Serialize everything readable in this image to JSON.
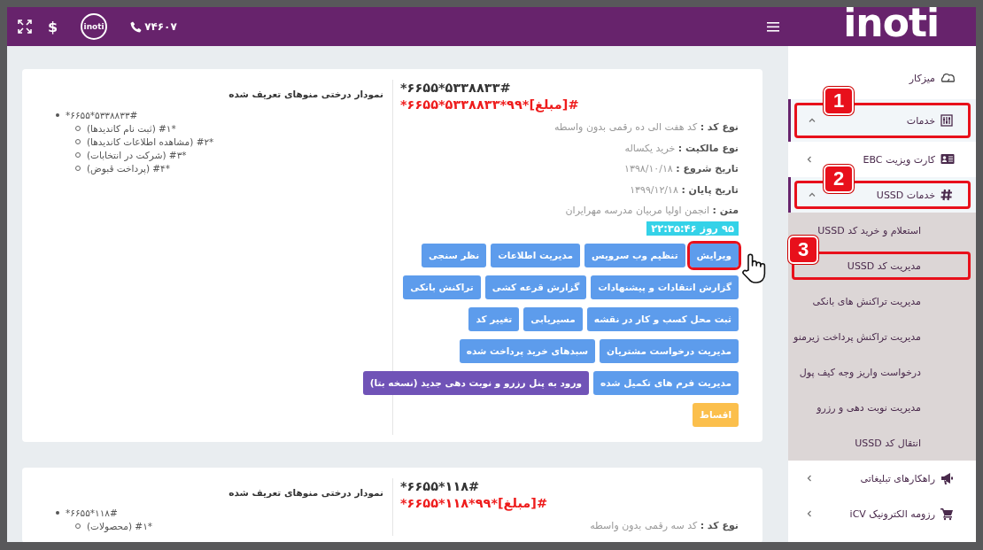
{
  "header": {
    "logo": "inoti",
    "badge_logo": "inoti",
    "currency": "$",
    "phone": "۷۴۶۰۷"
  },
  "cards": [
    {
      "code": "*۶۶۵۵*۵۳۳۸۸۳۳#",
      "dial_code": "*۶۶۵۵*۵۳۳۸۸۳۳*۹۹*[مبلغ]#",
      "fields": [
        {
          "label": "نوع کد :",
          "value": "کد هفت الی ده رقمی بدون واسطه"
        },
        {
          "label": "نوع مالکیت :",
          "value": "خرید یکساله"
        },
        {
          "label": "تاریخ شروع :",
          "value": "۱۳۹۸/۱۰/۱۸"
        },
        {
          "label": "تاریخ پایان :",
          "value": "۱۳۹۹/۱۲/۱۸"
        },
        {
          "label": "متن :",
          "value": "انجمن اولیا مربیان مدرسه مهرایران"
        }
      ],
      "timer": "۹۵ روز ۲۲:۳۵:۴۶",
      "button_rows": [
        [
          {
            "label": "ویرایش",
            "color": "#5d9cec",
            "highlighted": true
          },
          {
            "label": "تنظیم وب سرویس",
            "color": "#5d9cec",
            "highlighted": false
          },
          {
            "label": "مدیریت اطلاعات",
            "color": "#5d9cec",
            "highlighted": false
          },
          {
            "label": "نظر سنجی",
            "color": "#5d9cec",
            "highlighted": false
          }
        ],
        [
          {
            "label": "گزارش انتقادات و پیشنهادات",
            "color": "#5d9cec",
            "highlighted": false
          },
          {
            "label": "گزارش قرعه کشی",
            "color": "#5d9cec",
            "highlighted": false
          },
          {
            "label": "تراکنش بانکی",
            "color": "#5d9cec",
            "highlighted": false
          }
        ],
        [
          {
            "label": "ثبت محل کسب و کار در نقشه",
            "color": "#5d9cec",
            "highlighted": false
          },
          {
            "label": "مسیریابی",
            "color": "#5d9cec",
            "highlighted": false
          },
          {
            "label": "تغییر کد",
            "color": "#5d9cec",
            "highlighted": false
          }
        ],
        [
          {
            "label": "مدیریت درخواست مشتریان",
            "color": "#5d9cec",
            "highlighted": false
          },
          {
            "label": "سبدهای خرید پرداخت شده",
            "color": "#5d9cec",
            "highlighted": false
          }
        ],
        [
          {
            "label": "مدیریت فرم های تکمیل شده",
            "color": "#5d9cec",
            "highlighted": false
          },
          {
            "label": "ورود به پنل رزرو و نوبت دهی جدید (نسخه بتا)",
            "color": "#7053b7",
            "highlighted": false
          }
        ],
        [
          {
            "label": "اقساط",
            "color": "#fbbf4c",
            "highlighted": false
          }
        ]
      ],
      "tree": {
        "title": "نمودار درختی منوهای تعریف شده",
        "root": "*۶۶۵۵*۵۳۳۸۸۳۳#",
        "children": [
          "(ثبت نام کاندیدها) #۱*",
          "(مشاهده اطلاعات کاندیدها) #۲*",
          "(شرکت در انتخابات) #۳*",
          "(پرداخت قبوض) #۴*"
        ]
      }
    },
    {
      "code": "*۶۶۵۵*۱۱۸#",
      "dial_code": "*۶۶۵۵*۱۱۸*۹۹*[مبلغ]#",
      "fields": [
        {
          "label": "نوع کد :",
          "value": "کد سه رقمی بدون واسطه"
        }
      ],
      "tree": {
        "title": "نمودار درختی منوهای تعریف شده",
        "root": "*۶۶۵۵*۱۱۸#",
        "children": [
          "(محصولات) #۱*"
        ]
      }
    }
  ],
  "sidebar": {
    "items": [
      {
        "label": "میزکار",
        "selected": false
      },
      {
        "label": "خدمات",
        "selected": true,
        "expanded": true,
        "badge": "1",
        "children": [
          {
            "label": "کارت ویزیت EBC",
            "selected": false,
            "expanded": false
          },
          {
            "label": "خدمات USSD",
            "selected": true,
            "expanded": true,
            "badge": "2",
            "children": [
              {
                "label": "استعلام و خرید کد USSD",
                "selected": false
              },
              {
                "label": "مدیریت کد USSD",
                "selected": false,
                "badge": "3"
              },
              {
                "label": "مدیریت تراکنش های بانکی",
                "selected": false
              },
              {
                "label": "مدیریت تراکنش پرداخت زیرمنو",
                "selected": false
              },
              {
                "label": "درخواست واریز وجه کیف پول",
                "selected": false
              },
              {
                "label": "مدیریت نوبت دهی و رزرو",
                "selected": false
              },
              {
                "label": "انتقال کد USSD",
                "selected": false
              }
            ]
          },
          {
            "label": "راهکارهای تبلیغاتی",
            "selected": false,
            "expanded": false
          },
          {
            "label": "رزومه الکترونیک iCV",
            "selected": false,
            "expanded": false
          }
        ]
      }
    ]
  }
}
